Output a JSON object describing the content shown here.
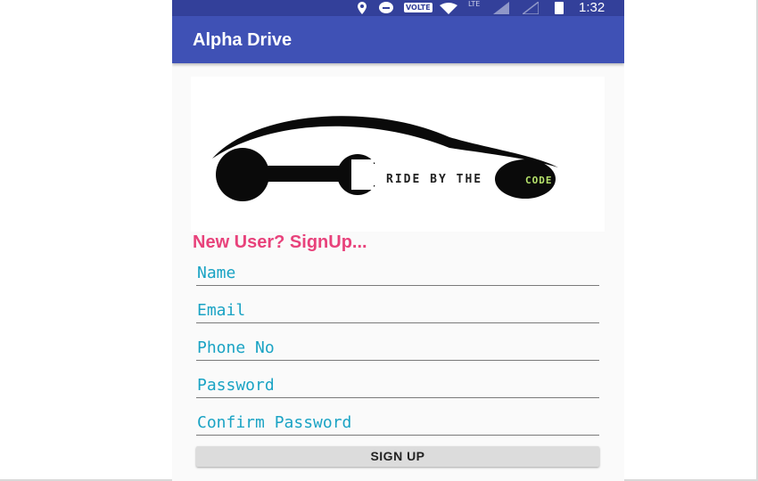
{
  "status_bar": {
    "time": "1:32",
    "network_badge": "VOLTE",
    "lte_label": "LTE",
    "icons": [
      "location-icon",
      "do-not-disturb-icon",
      "volte-icon",
      "wifi-icon",
      "signal-icon",
      "signal-icon",
      "battery-icon"
    ]
  },
  "app_bar": {
    "title": "Alpha Drive"
  },
  "logo": {
    "text_dark": "RIDE BY THE",
    "text_green": "CODE"
  },
  "form": {
    "heading": "New User? SignUp...",
    "fields": [
      {
        "placeholder": "Name"
      },
      {
        "placeholder": "Email"
      },
      {
        "placeholder": "Phone No"
      },
      {
        "placeholder": "Password"
      },
      {
        "placeholder": "Confirm Password"
      }
    ],
    "submit_label": "SIGN UP"
  },
  "colors": {
    "status_bar": "#33409a",
    "app_bar": "#3f51b5",
    "heading": "#e8427b",
    "field_text": "#1aa3c4",
    "button": "#dcdcdc"
  }
}
